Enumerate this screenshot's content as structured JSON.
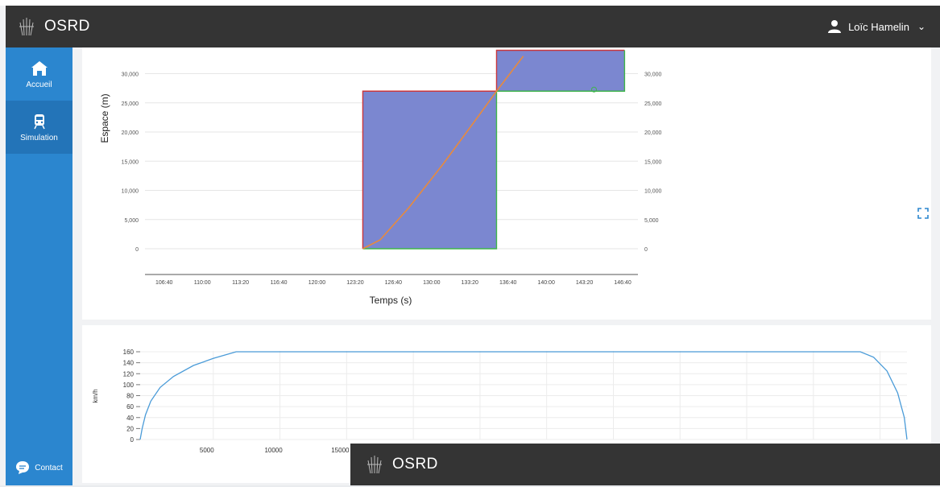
{
  "header": {
    "app_name": "OSRD",
    "user_name": "Loïc Hamelin",
    "user_icon": "user-icon",
    "chevron_icon": "chevron-down-icon"
  },
  "sidebar": {
    "items": [
      {
        "label": "Accueil",
        "icon": "home-icon"
      },
      {
        "label": "Simulation",
        "icon": "train-icon"
      }
    ],
    "contact_label": "Contact"
  },
  "overlay": {
    "app_name": "OSRD"
  },
  "chart_data": [
    {
      "type": "area",
      "xlabel": "Temps (s)",
      "ylabel": "Espace (m)",
      "x_ticks": [
        "106:40",
        "110:00",
        "113:20",
        "116:40",
        "120:00",
        "123:20",
        "126:40",
        "130:00",
        "133:20",
        "136:40",
        "140:00",
        "143:20",
        "146:40"
      ],
      "y_ticks": [
        "0",
        "5,000",
        "10,000",
        "15,000",
        "20,000",
        "25,000",
        "30,000"
      ],
      "y_ticks_right": [
        "0",
        "5,000",
        "10,000",
        "15,000",
        "20,000",
        "25,000",
        "30,000"
      ],
      "ylim": [
        0,
        32000
      ],
      "blocks": [
        {
          "start": "124:00",
          "end": "135:40",
          "bottom": 0,
          "top": 27000
        },
        {
          "start": "135:40",
          "end": "146:50",
          "bottom": 27000,
          "top": 34000
        }
      ],
      "train_curve": [
        {
          "t": "124:00",
          "s": 0
        },
        {
          "t": "125:30",
          "s": 1500
        },
        {
          "t": "128:00",
          "s": 7000
        },
        {
          "t": "131:00",
          "s": 14500
        },
        {
          "t": "134:00",
          "s": 22500
        },
        {
          "t": "135:40",
          "s": 27000
        },
        {
          "t": "138:00",
          "s": 33000
        }
      ],
      "marker": {
        "t": "144:10",
        "s": 27000
      },
      "colors": {
        "block_fill": "#7b87d0",
        "block_border_top": "#c9363c",
        "block_border_bottom": "#3fb54b",
        "curve": "#e88a3c"
      }
    },
    {
      "type": "line",
      "xlabel": "",
      "ylabel": "km/h",
      "x_ticks": [
        "5000",
        "10000",
        "15000"
      ],
      "y_ticks": [
        "0",
        "20",
        "40",
        "60",
        "80",
        "100",
        "120",
        "140",
        "160"
      ],
      "ylim": [
        0,
        165
      ],
      "xlim": [
        0,
        57500
      ],
      "series": [
        {
          "color": "#4a9bd8",
          "points": [
            [
              0,
              0
            ],
            [
              150,
              20
            ],
            [
              400,
              45
            ],
            [
              800,
              70
            ],
            [
              1500,
              95
            ],
            [
              2500,
              115
            ],
            [
              4000,
              135
            ],
            [
              5500,
              148
            ],
            [
              7200,
              160
            ],
            [
              54000,
              160
            ],
            [
              55000,
              150
            ],
            [
              56000,
              125
            ],
            [
              56800,
              85
            ],
            [
              57300,
              40
            ],
            [
              57500,
              0
            ]
          ]
        }
      ]
    }
  ]
}
